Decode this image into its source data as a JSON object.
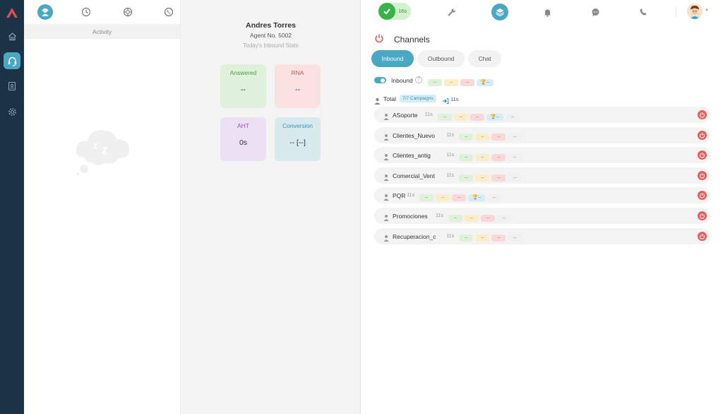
{
  "colors": {
    "rail": "#1b3347",
    "accent": "#4aa8c4",
    "success": "#3ab24a",
    "danger": "#e85c5c"
  },
  "rail": {
    "icons": [
      "logo-icon",
      "home-icon",
      "headset-icon",
      "id-card-icon",
      "gear-icon"
    ],
    "active": "headset-icon"
  },
  "left_panel": {
    "tabs": [
      "agent-icon",
      "clock-icon",
      "globe-icon",
      "phone-history-icon"
    ],
    "active_tab": 0,
    "header": "Activity",
    "empty_state_icon": "sleeping-cloud-icon"
  },
  "agent": {
    "name": "Andres Torres",
    "number": "Agent No. 5002",
    "subtitle": "Today's Inbound Stats"
  },
  "stats": {
    "answered": {
      "label": "Answered",
      "value": "--"
    },
    "rna": {
      "label": "RNA",
      "value": "--"
    },
    "aht": {
      "label": "AHT",
      "value": "0s"
    },
    "conversion": {
      "label": "Conversion",
      "value": "-- [--]"
    }
  },
  "topbar": {
    "status_timer": "16s",
    "icons": [
      "check-icon",
      "wrench-icon",
      "layers-icon",
      "bell-icon",
      "chat-icon",
      "phone-icon",
      "avatar"
    ],
    "active": "layers-icon"
  },
  "channels": {
    "title": "Channels",
    "tabs": [
      {
        "label": "Inbound",
        "active": true
      },
      {
        "label": "Outbound",
        "active": false
      },
      {
        "label": "Chat",
        "active": false
      }
    ],
    "inbound_toggle": {
      "label": "Inbound",
      "on": true,
      "chips": [
        "--",
        "--",
        "--",
        "--"
      ]
    },
    "total": {
      "label": "Total",
      "campaigns_badge": "7/7 Campaigns",
      "time": "11s"
    },
    "campaigns": [
      {
        "name": "ASoporte",
        "time": "11s",
        "trophy": true,
        "chips": [
          "--",
          "--",
          "--",
          "--",
          "--"
        ]
      },
      {
        "name": "Clientes_Nuevo",
        "time": "11s",
        "trophy": false,
        "chips": [
          "--",
          "--",
          "--",
          "--"
        ]
      },
      {
        "name": "Clientes_antig",
        "time": "11s",
        "trophy": false,
        "chips": [
          "--",
          "--",
          "--",
          "--"
        ]
      },
      {
        "name": "Comercial_Vent",
        "time": "11s",
        "trophy": false,
        "chips": [
          "--",
          "--",
          "--",
          "--"
        ]
      },
      {
        "name": "PQR",
        "time": "11s",
        "trophy": true,
        "chips": [
          "--",
          "--",
          "--",
          "--",
          "--"
        ]
      },
      {
        "name": "Promociones",
        "time": "11s",
        "trophy": false,
        "chips": [
          "--",
          "--",
          "--",
          "--"
        ]
      },
      {
        "name": "Recuperacion_c",
        "time": "11s",
        "trophy": false,
        "chips": [
          "--",
          "--",
          "--",
          "--"
        ]
      }
    ]
  }
}
